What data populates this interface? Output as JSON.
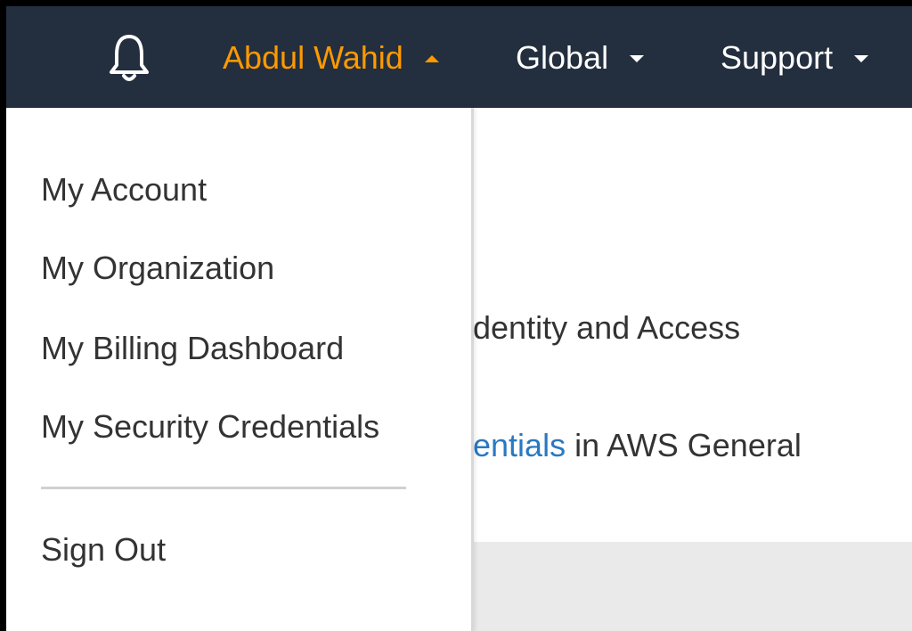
{
  "topnav": {
    "bell_icon": "bell-icon",
    "user_label": "Abdul Wahid",
    "region_label": "Global",
    "support_label": "Support",
    "colors": {
      "background": "#232f3e",
      "user_accent": "#ff9900",
      "text": "#ffffff"
    }
  },
  "background_content": {
    "line1_text": "dentity and Access",
    "line2_link": "entials",
    "line2_text": " in AWS General"
  },
  "user_menu": {
    "items": [
      {
        "label": "My Account"
      },
      {
        "label": "My Organization"
      },
      {
        "label": "My Billing Dashboard"
      },
      {
        "label": "My Security Credentials"
      }
    ],
    "sign_out_label": "Sign Out"
  }
}
